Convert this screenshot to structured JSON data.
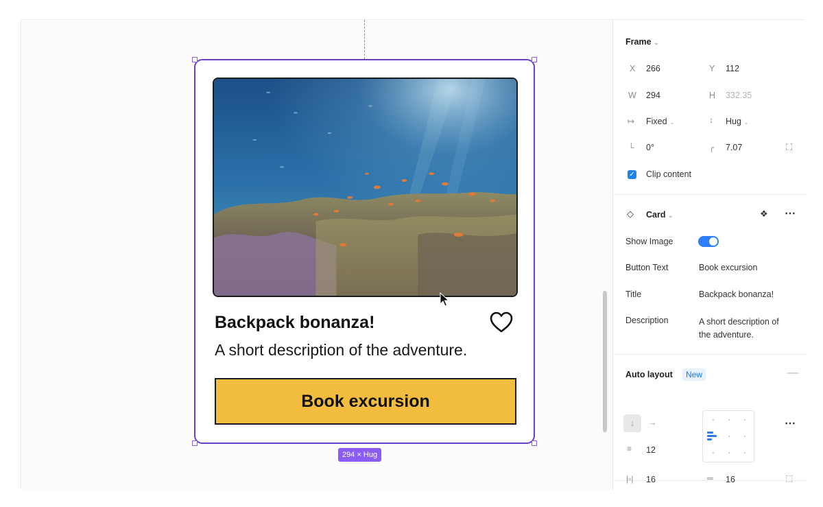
{
  "canvas": {
    "card": {
      "title": "Backpack bonanza!",
      "description": "A short description of the adventure.",
      "button_label": "Book excursion",
      "image_alt": "coral reef with fish"
    },
    "size_badge": "294 × Hug"
  },
  "panel": {
    "frame": {
      "header": "Frame",
      "x_label": "X",
      "x_value": "266",
      "y_label": "Y",
      "y_value": "112",
      "w_label": "W",
      "w_value": "294",
      "h_label": "H",
      "h_value": "332.35",
      "width_mode": "Fixed",
      "height_mode": "Hug",
      "rotation": "0°",
      "corner_radius": "7.07",
      "clip_content_label": "Clip content",
      "clip_content_checked": true
    },
    "component": {
      "name": "Card",
      "props": [
        {
          "label": "Show Image",
          "type": "toggle",
          "value": true
        },
        {
          "label": "Button Text",
          "value": "Book excursion"
        },
        {
          "label": "Title",
          "value": "Backpack bonanza!"
        },
        {
          "label": "Description",
          "value_line1": "A short description of",
          "value_line2": "the adventure."
        }
      ]
    },
    "auto_layout": {
      "header": "Auto layout",
      "badge": "New",
      "gap": "12",
      "padding_horizontal": "16",
      "padding_vertical": "16",
      "direction": "vertical"
    }
  },
  "colors": {
    "selection": "#8a5cf5",
    "button_fill": "#f2bd3e",
    "accent_blue": "#2d7ff9"
  }
}
